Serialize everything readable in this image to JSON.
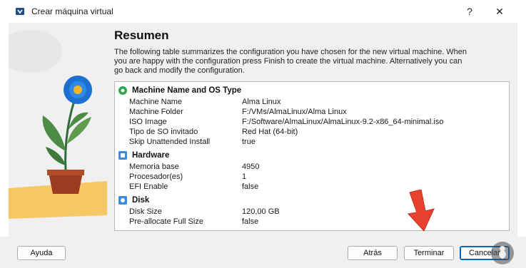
{
  "window": {
    "title": "Crear máquina virtual",
    "help_glyph": "?",
    "close_glyph": "✕"
  },
  "page": {
    "heading": "Resumen",
    "description": "The following table summarizes the configuration you have chosen for the new virtual machine. When you are happy with the configuration press Finish to create the virtual machine. Alternatively you can go back and modify the configuration."
  },
  "summary": {
    "groups": [
      {
        "title": "Machine Name and OS Type",
        "icon": "puzzle-piece-icon",
        "rows": [
          {
            "key": "Machine Name",
            "value": "Alma Linux"
          },
          {
            "key": "Machine Folder",
            "value": "F:/VMs/AlmaLinux/Alma Linux"
          },
          {
            "key": "ISO Image",
            "value": "F:/Software/AlmaLinux/AlmaLinux-9.2-x86_64-minimal.iso"
          },
          {
            "key": "Tipo de SO invitado",
            "value": "Red Hat (64-bit)"
          },
          {
            "key": "Skip Unattended Install",
            "value": "true"
          }
        ]
      },
      {
        "title": "Hardware",
        "icon": "hardware-chip-icon",
        "rows": [
          {
            "key": "Memoria base",
            "value": "4950"
          },
          {
            "key": "Procesador(es)",
            "value": "1"
          },
          {
            "key": "EFI Enable",
            "value": "false"
          }
        ]
      },
      {
        "title": "Disk",
        "icon": "disk-icon",
        "rows": [
          {
            "key": "Disk Size",
            "value": "120,00 GB"
          },
          {
            "key": "Pre-allocate Full Size",
            "value": "false"
          }
        ]
      }
    ]
  },
  "buttons": {
    "help": "Ayuda",
    "back": "Atrás",
    "finish": "Terminar",
    "cancel": "Cancelar"
  },
  "colors": {
    "accent": "#0067c0",
    "group_icon_green": "#2ea44f",
    "group_icon_blue": "#3c8ad8",
    "arrow_red": "#e8412f"
  }
}
